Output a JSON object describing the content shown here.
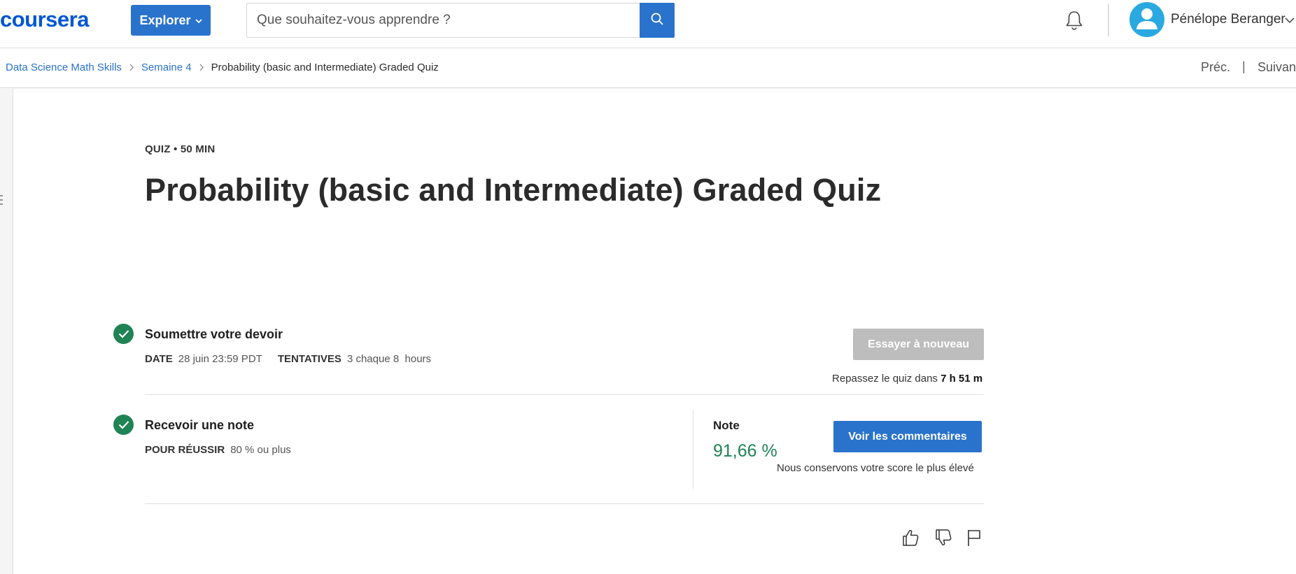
{
  "header": {
    "logo_text": "coursera",
    "explore_label": "Explorer",
    "search": {
      "placeholder": "Que souhaitez-vous apprendre ?",
      "value": ""
    },
    "user_name": "Pénélope Beranger"
  },
  "breadcrumb": {
    "items": [
      {
        "label": "Data Science Math Skills"
      },
      {
        "label": "Semaine 4"
      },
      {
        "label": "Probability (basic and Intermediate) Graded Quiz"
      }
    ],
    "prev_label": "Préc.",
    "separator": "|",
    "next_label": "Suivan"
  },
  "quiz": {
    "kicker": "QUIZ • 50  MIN",
    "title": "Probability (basic and Intermediate) Graded Quiz",
    "submit": {
      "heading": "Soumettre votre devoir",
      "due_key": "DATE",
      "due_value": "28 juin 23:59 PDT",
      "attempts_key": "TENTATIVES",
      "attempts_value": "3 chaque 8  hours",
      "retry_button": "Essayer à nouveau",
      "retry_note_prefix": "Repassez le quiz dans ",
      "retry_note_time": "7 h 51 m"
    },
    "grade": {
      "heading": "Recevoir une note",
      "pass_key": "POUR RÉUSSIR",
      "pass_value": "80 % ou plus",
      "label": "Note",
      "value": "91,66 %",
      "feedback_button": "Voir les commentaires",
      "keep_note": "Nous conservons votre score le plus élevé"
    }
  },
  "colors": {
    "brand": "#0056d2",
    "primary_button": "#2a73cc",
    "success": "#1f8354",
    "disabled": "#bdbdbd"
  },
  "icons": {
    "search": "search-icon",
    "bell": "bell-icon",
    "avatar": "user-avatar-icon",
    "like": "thumbs-up-icon",
    "dislike": "thumbs-down-icon",
    "flag": "flag-icon"
  }
}
